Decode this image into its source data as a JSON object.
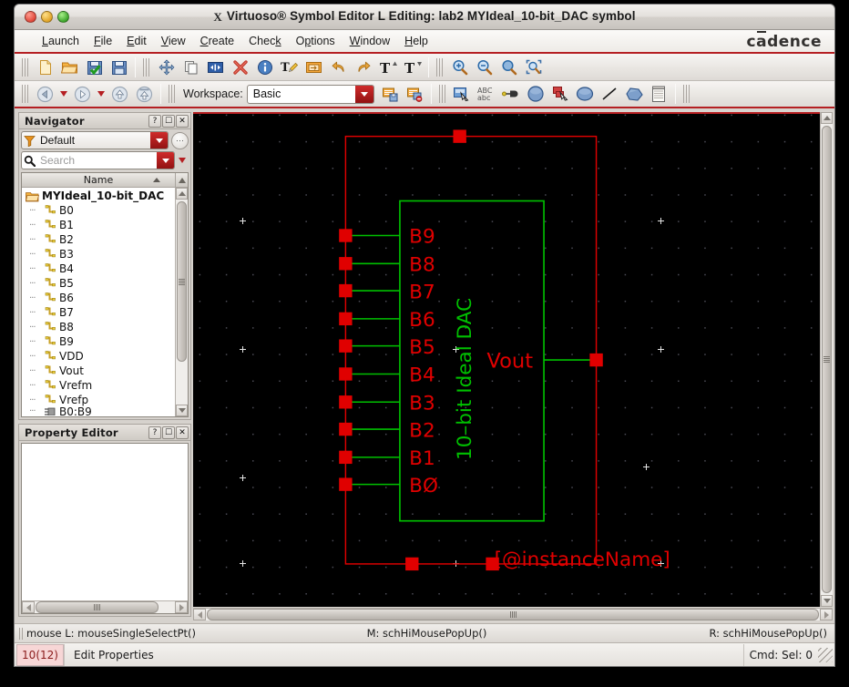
{
  "window": {
    "title": "Virtuoso® Symbol Editor L Editing: lab2 MYIdeal_10-bit_DAC symbol",
    "title_icon": "X",
    "brand": "cadence",
    "traffic_lights": [
      "close",
      "minimize",
      "maximize"
    ]
  },
  "menubar": {
    "items": [
      {
        "label": "Launch",
        "mnemonic": "L"
      },
      {
        "label": "File",
        "mnemonic": "F"
      },
      {
        "label": "Edit",
        "mnemonic": "E"
      },
      {
        "label": "View",
        "mnemonic": "V"
      },
      {
        "label": "Create",
        "mnemonic": "C"
      },
      {
        "label": "Check",
        "mnemonic": "k"
      },
      {
        "label": "Options",
        "mnemonic": "p"
      },
      {
        "label": "Window",
        "mnemonic": "W"
      },
      {
        "label": "Help",
        "mnemonic": "H"
      }
    ]
  },
  "toolbar_row1": {
    "group_file": [
      "new-file-icon",
      "open-folder-icon",
      "save-check-icon",
      "save-icon"
    ],
    "group_edit": [
      "move-icon",
      "copy-icon",
      "stretch-icon",
      "delete-x-icon",
      "info-icon",
      "property-edit-icon",
      "instance-icon",
      "undo-icon",
      "redo-icon",
      "text-up-icon",
      "text-down-icon"
    ],
    "group_zoom": [
      "zoom-in-icon",
      "zoom-out-icon",
      "zoom-fit-icon",
      "zoom-area-icon"
    ]
  },
  "toolbar_row2": {
    "nav_buttons": [
      "back-icon",
      "back-dropdown-icon",
      "forward-icon",
      "forward-dropdown-icon",
      "up-icon",
      "up-top-icon"
    ],
    "workspace": {
      "label": "Workspace:",
      "value": "Basic",
      "placeholder": "Basic"
    },
    "workspace_buttons": [
      "save-workspace-icon",
      "delete-workspace-icon"
    ],
    "draw_tools": [
      "select-icon",
      "abc-label-icon",
      "pin-icon",
      "circle-icon",
      "rect-select-icon",
      "ellipse-icon",
      "line-icon",
      "polygon-icon",
      "note-icon"
    ]
  },
  "navigator": {
    "title": "Navigator",
    "header_buttons": [
      "help-button",
      "undock-button",
      "close-button"
    ],
    "filter": {
      "value": "Default",
      "icon": "filter-icon"
    },
    "search": {
      "placeholder": "Search",
      "value": "",
      "icon": "search-icon"
    },
    "column_header": "Name",
    "tree": {
      "root": {
        "label": "MYIdeal_10-bit_DAC",
        "icon": "folder-open-icon"
      },
      "children": [
        {
          "label": "B0",
          "icon": "pin-icon"
        },
        {
          "label": "B1",
          "icon": "pin-icon"
        },
        {
          "label": "B2",
          "icon": "pin-icon"
        },
        {
          "label": "B3",
          "icon": "pin-icon"
        },
        {
          "label": "B4",
          "icon": "pin-icon"
        },
        {
          "label": "B5",
          "icon": "pin-icon"
        },
        {
          "label": "B6",
          "icon": "pin-icon"
        },
        {
          "label": "B7",
          "icon": "pin-icon"
        },
        {
          "label": "B8",
          "icon": "pin-icon"
        },
        {
          "label": "B9",
          "icon": "pin-icon"
        },
        {
          "label": "VDD",
          "icon": "pin-icon"
        },
        {
          "label": "Vout",
          "icon": "pin-icon"
        },
        {
          "label": "Vrefm",
          "icon": "pin-icon"
        },
        {
          "label": "Vrefp",
          "icon": "pin-icon"
        },
        {
          "label": "B0:B9",
          "icon": "bus-icon"
        }
      ]
    }
  },
  "property_editor": {
    "title": "Property Editor",
    "header_buttons": [
      "help-button",
      "undock-button",
      "close-button"
    ],
    "content": ""
  },
  "canvas": {
    "background_color": "#000000",
    "grid_dot_color": "#5a5a66",
    "symbol_outline_color": "#00c000",
    "pin_color": "#e00000",
    "label_color": "#e00000",
    "body_label": "10-bit Ideal DAC",
    "instance_label": "[@instanceName]",
    "output_pin": "Vout",
    "input_pins": [
      "B9",
      "B8",
      "B7",
      "B6",
      "B5",
      "B4",
      "B3",
      "B2",
      "B1",
      "B0"
    ],
    "selection_boundary_color": "#e00000"
  },
  "mousebar": {
    "left": "mouse L: mouseSingleSelectPt()",
    "middle": "M: schHiMousePopUp()",
    "right": "R: schHiMousePopUp()"
  },
  "statusbar": {
    "count": "10(12)",
    "message": "Edit Properties",
    "cmd": "Cmd: Sel: 0"
  }
}
